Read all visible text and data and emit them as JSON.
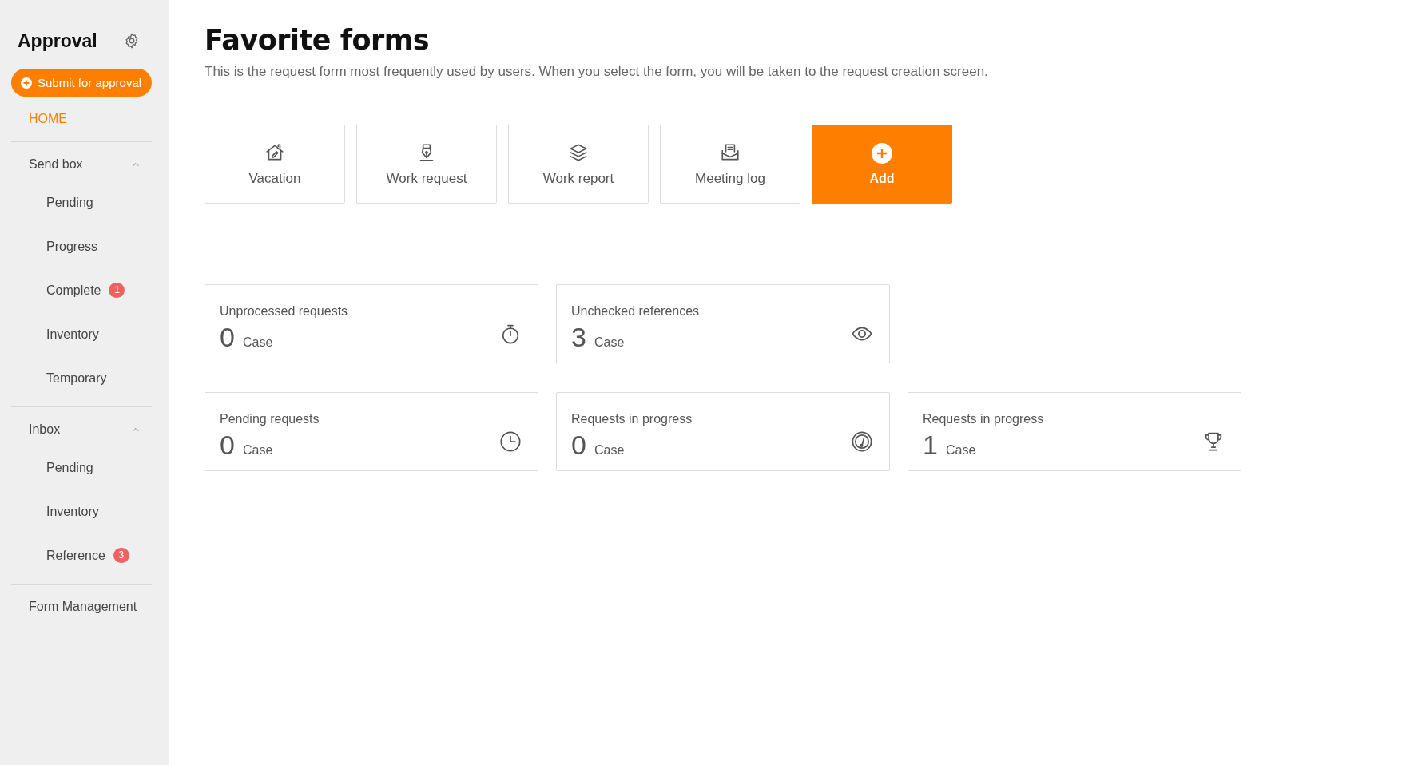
{
  "sidebar": {
    "title": "Approval",
    "submit_button": "Submit for approval",
    "items": [
      {
        "kind": "link",
        "label": "HOME",
        "selected": true
      },
      {
        "kind": "group",
        "label": "Send box",
        "selected": false,
        "expanded": true,
        "children": [
          {
            "label": "Pending",
            "selected": false
          },
          {
            "label": "Progress",
            "selected": false
          },
          {
            "label": "Complete",
            "selected": false,
            "badge": "1"
          },
          {
            "label": "Inventory",
            "selected": false
          },
          {
            "label": "Temporary",
            "selected": false
          }
        ]
      },
      {
        "kind": "group",
        "label": "Inbox",
        "selected": false,
        "expanded": true,
        "children": [
          {
            "label": "Pending",
            "selected": false
          },
          {
            "label": "Inventory",
            "selected": false
          },
          {
            "label": "Reference",
            "selected": false,
            "badge": "3"
          }
        ]
      },
      {
        "kind": "link",
        "label": "Form Management",
        "selected": false
      }
    ]
  },
  "main": {
    "title": "Favorite forms",
    "description": "This is the request form most frequently used by users. When you select the form, you will be taken to the request creation screen.",
    "forms": [
      {
        "kind": "form",
        "label": "Vacation"
      },
      {
        "kind": "form",
        "label": "Work request"
      },
      {
        "kind": "form",
        "label": "Work report"
      },
      {
        "kind": "form",
        "label": "Meeting log"
      },
      {
        "kind": "add",
        "label": "Add"
      }
    ],
    "stat_rows": [
      [
        {
          "label": "Unprocessed requests",
          "value": "0",
          "unit": "Case"
        },
        {
          "label": "Unchecked references",
          "value": "3",
          "unit": "Case"
        }
      ],
      [
        {
          "label": "Pending requests",
          "value": "0",
          "unit": "Case"
        },
        {
          "label": "Requests in progress",
          "value": "0",
          "unit": "Case"
        },
        {
          "label": "Requests in progress",
          "value": "1",
          "unit": "Case"
        }
      ]
    ]
  }
}
